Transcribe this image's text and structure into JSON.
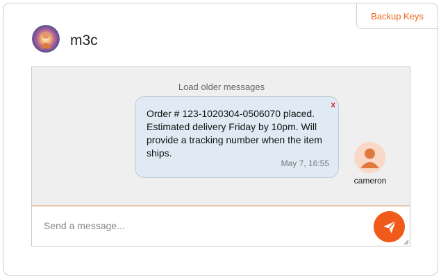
{
  "header": {
    "backup_keys_label": "Backup Keys",
    "contact_name": "m3c",
    "contact_avatar_icon": "contact-avatar-icon"
  },
  "chat": {
    "load_older_label": "Load older messages",
    "messages": [
      {
        "text": "Order # 123-1020304-0506070 placed. Estimated delivery Friday by 10pm. Will provide a tracking number when the item ships.",
        "timestamp": "May 7, 16:55",
        "sender": "cameron",
        "close_label": "x"
      }
    ]
  },
  "composer": {
    "placeholder": "Send a message...",
    "send_icon": "send-icon"
  },
  "colors": {
    "accent": "#f05a1a",
    "bubble_bg": "#dfeaf5",
    "chat_bg": "#efefef"
  }
}
